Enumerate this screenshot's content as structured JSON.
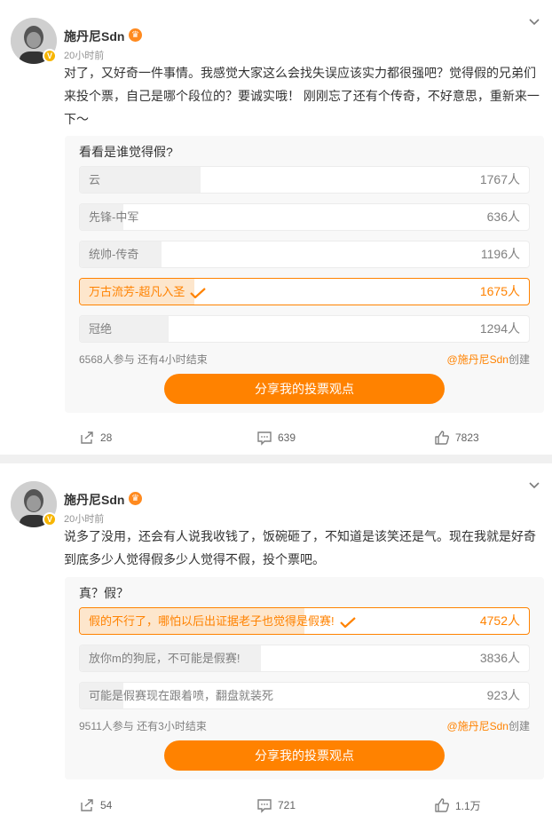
{
  "posts": [
    {
      "author": "施丹尼Sdn",
      "time": "20小时前",
      "content": "对了，又好奇一件事情。我感觉大家这么会找失误应该实力都很强吧？觉得假的兄弟们来投个票，自己是哪个段位的？要诚实哦！ 刚刚忘了还有个传奇，不好意思，重新来一下～",
      "poll": {
        "title": "看看是谁觉得假?",
        "options": [
          {
            "label": "云",
            "count": "1767人",
            "share": 0.269,
            "selected": false
          },
          {
            "label": "先锋-中军",
            "count": "636人",
            "share": 0.097,
            "selected": false
          },
          {
            "label": "统帅-传奇",
            "count": "1196人",
            "share": 0.182,
            "selected": false
          },
          {
            "label": "万古流芳-超凡入圣",
            "count": "1675人",
            "share": 0.255,
            "selected": true
          },
          {
            "label": "冠绝",
            "count": "1294人",
            "share": 0.197,
            "selected": false
          }
        ],
        "meta": "6568人参与 还有4小时结束",
        "creator_at": "@施丹尼Sdn",
        "creator_suffix": "创建",
        "share_label": "分享我的投票观点"
      },
      "actions": {
        "repost": "28",
        "comment": "639",
        "like": "7823"
      }
    },
    {
      "author": "施丹尼Sdn",
      "time": "20小时前",
      "content": "说多了没用，还会有人说我收钱了，饭碗砸了，不知道是该笑还是气。现在我就是好奇到底多少人觉得假多少人觉得不假，投个票吧。",
      "poll": {
        "title": "真？假？",
        "options": [
          {
            "label": "假的不行了，哪怕以后出证据老子也觉得是假赛!",
            "count": "4752人",
            "share": 0.5,
            "selected": true
          },
          {
            "label": "放你m的狗屁，不可能是假赛!",
            "count": "3836人",
            "share": 0.403,
            "selected": false
          },
          {
            "label": "可能是假赛现在跟着喷，翻盘就装死",
            "count": "923人",
            "share": 0.097,
            "selected": false
          }
        ],
        "meta": "9511人参与 还有3小时结束",
        "creator_at": "@施丹尼Sdn",
        "creator_suffix": "创建",
        "share_label": "分享我的投票观点"
      },
      "actions": {
        "repost": "54",
        "comment": "721",
        "like": "1.1万"
      }
    }
  ],
  "colors": {
    "accent": "#ff8200",
    "muted": "#808080",
    "pollBg": "#f8f8f8"
  },
  "icons": [
    "verified-badge-icon",
    "crown-badge-icon",
    "chevron-down-icon",
    "check-icon",
    "repost-icon",
    "comment-icon",
    "like-icon"
  ]
}
